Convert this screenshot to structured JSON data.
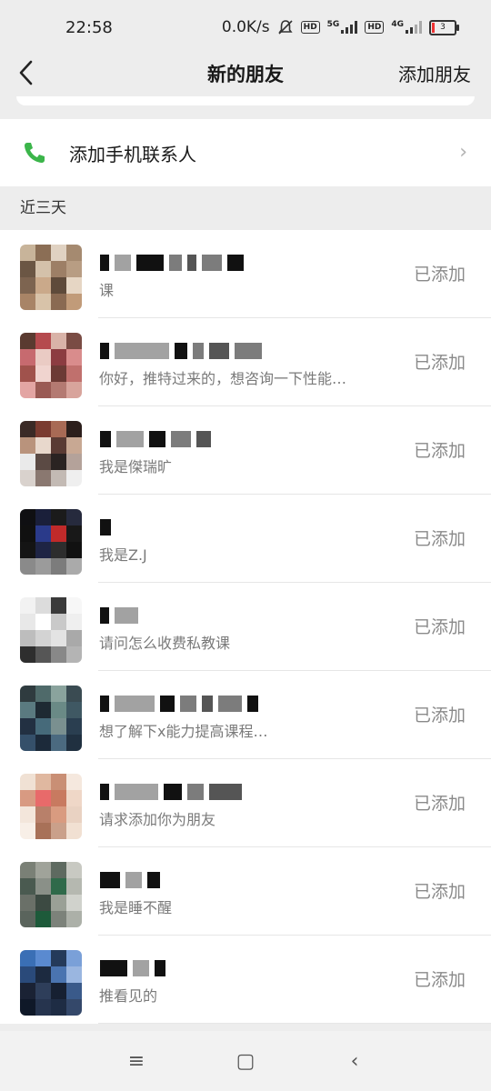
{
  "status_bar": {
    "time": "22:58",
    "net_speed": "0.0K/s",
    "hd1": "HD",
    "net1": "5G",
    "hd2": "HD",
    "net2": "4G",
    "battery": "3"
  },
  "nav": {
    "back_icon": "chevron-left-icon",
    "title": "新的朋友",
    "action": "添加朋友"
  },
  "contacts_row": {
    "icon": "phone-icon",
    "label": "添加手机联系人",
    "chevron": "›",
    "icon_color": "#3bb54a"
  },
  "section": {
    "title": "近三天"
  },
  "requests": [
    {
      "message": "课",
      "status": "已添加",
      "avatar_colors": [
        "#c8b49a",
        "#8b6e55",
        "#e0d2c2",
        "#a58a70",
        "#6b5644",
        "#d4c1aa",
        "#9d7f66",
        "#b89d83",
        "#7d6450",
        "#caa98a",
        "#5e4a3a",
        "#e6d6c4",
        "#a88466",
        "#d8c3a9",
        "#8a6a52",
        "#c19b79"
      ]
    },
    {
      "message": "你好，推特过来的，想咨询一下性能…",
      "status": "已添加",
      "avatar_colors": [
        "#5a3a30",
        "#b54a4e",
        "#d9b3a8",
        "#7a4c44",
        "#c76a6f",
        "#eacbc4",
        "#8c3c41",
        "#d98c8c",
        "#a0524c",
        "#f0d4cf",
        "#6c3a35",
        "#c0706d",
        "#e3a5a3",
        "#9a5a54",
        "#b47a72",
        "#d8a49c"
      ]
    },
    {
      "message": "我是傑瑞旷",
      "status": "已添加",
      "avatar_colors": [
        "#3a2a26",
        "#7a3b30",
        "#a86a55",
        "#2c1f1c",
        "#b9937c",
        "#e8d8cc",
        "#5a3b34",
        "#c8a893",
        "#eaeaea",
        "#5b4a44",
        "#2a2322",
        "#b4a29a",
        "#d9d2cd",
        "#8a7870",
        "#c3bab4",
        "#efefef"
      ]
    },
    {
      "message": "我是Z.J",
      "status": "已添加",
      "avatar_colors": [
        "#0f0f12",
        "#1a1f3a",
        "#1b1b1b",
        "#262a3d",
        "#101010",
        "#2a3a8a",
        "#c02a2a",
        "#181818",
        "#141414",
        "#1e2444",
        "#2d2d2d",
        "#111111",
        "#8a8a8a",
        "#9b9b9b",
        "#7c7c7c",
        "#aaaaaa"
      ]
    },
    {
      "message": "请问怎么收费私教课",
      "status": "已添加",
      "avatar_colors": [
        "#f2f2f2",
        "#dcdcdc",
        "#3a3a3a",
        "#f7f7f7",
        "#e8e8e8",
        "#ffffff",
        "#c9c9c9",
        "#efefef",
        "#bdbdbd",
        "#d3d3d3",
        "#e3e3e3",
        "#a9a9a9",
        "#2e2e2e",
        "#565656",
        "#888888",
        "#b4b4b4"
      ]
    },
    {
      "message": "想了解下x能力提高课程…",
      "status": "已添加",
      "avatar_colors": [
        "#2f3b3f",
        "#4f6a6a",
        "#8aa39d",
        "#3a4b52",
        "#5a7a80",
        "#1e2a33",
        "#6a8a86",
        "#3f5863",
        "#223042",
        "#466a7a",
        "#7a9090",
        "#2a3e50",
        "#35506a",
        "#1c2a3a",
        "#4b6a80",
        "#203040"
      ]
    },
    {
      "message": "请求添加你为朋友",
      "status": "已添加",
      "avatar_colors": [
        "#f0e1d4",
        "#e0b8a0",
        "#c98f75",
        "#f5e8de",
        "#d89a82",
        "#e86a6a",
        "#c87a60",
        "#efd7c7",
        "#f3e6db",
        "#b8806a",
        "#d99b80",
        "#e9d2c2",
        "#f8efe7",
        "#a87158",
        "#caa08a",
        "#f1e0d2"
      ]
    },
    {
      "message": "我是睡不醒",
      "status": "已添加",
      "avatar_colors": [
        "#7a8076",
        "#a0a39a",
        "#5e6a60",
        "#c8c9c2",
        "#4a5a50",
        "#8a9088",
        "#2f6a4a",
        "#b5b8b0",
        "#6a7068",
        "#3c4a42",
        "#9aa096",
        "#d0d2cc",
        "#5a645c",
        "#1d5a3a",
        "#7c827a",
        "#acb0a8"
      ]
    },
    {
      "message": "推看见的",
      "status": "已添加",
      "avatar_colors": [
        "#3a6fb5",
        "#5a8ad0",
        "#243a5a",
        "#7aa0d8",
        "#2a4a7a",
        "#1c2a40",
        "#4a74b0",
        "#9ab6e0",
        "#1a2234",
        "#2e3e5a",
        "#162032",
        "#3a5a8a",
        "#0f1828",
        "#26344e",
        "#1e2c44",
        "#34486a"
      ]
    }
  ],
  "system_nav": {
    "menu": "≡",
    "home": "▢",
    "back": "‹"
  }
}
